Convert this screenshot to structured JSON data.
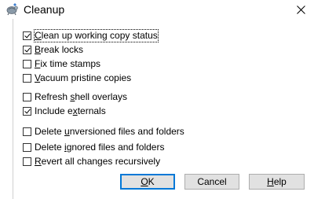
{
  "window": {
    "title": "Cleanup",
    "app_icon": "tortoise-icon",
    "close_icon": "close-icon"
  },
  "options": [
    {
      "id": "cleanup-working-copy",
      "prefix": "",
      "key": "C",
      "rest": "lean up working copy status",
      "checked": true,
      "focused": true
    },
    {
      "id": "break-locks",
      "prefix": "",
      "key": "B",
      "rest": "reak locks",
      "checked": true,
      "focused": false
    },
    {
      "id": "fix-time-stamps",
      "prefix": "",
      "key": "F",
      "rest": "ix time stamps",
      "checked": false,
      "focused": false
    },
    {
      "id": "vacuum-pristine",
      "prefix": "",
      "key": "V",
      "rest": "acuum pristine copies",
      "checked": false,
      "focused": false
    },
    {
      "id": "refresh-shell-overlays",
      "prefix": "Refresh ",
      "key": "s",
      "rest": "hell overlays",
      "checked": false,
      "focused": false
    },
    {
      "id": "include-externals",
      "prefix": "Include e",
      "key": "x",
      "rest": "ternals",
      "checked": true,
      "focused": false
    },
    {
      "id": "delete-unversioned",
      "prefix": "Delete ",
      "key": "u",
      "rest": "nversioned files and folders",
      "checked": false,
      "focused": false
    },
    {
      "id": "delete-ignored",
      "prefix": "Delete ",
      "key": "i",
      "rest": "gnored files and folders",
      "checked": false,
      "focused": false
    },
    {
      "id": "revert-all",
      "prefix": "",
      "key": "R",
      "rest": "evert all changes recursively",
      "checked": false,
      "focused": false
    }
  ],
  "buttons": {
    "ok": {
      "key": "O",
      "rest": "K"
    },
    "cancel": {
      "label": "Cancel"
    },
    "help": {
      "key": "H",
      "rest": "elp"
    }
  }
}
